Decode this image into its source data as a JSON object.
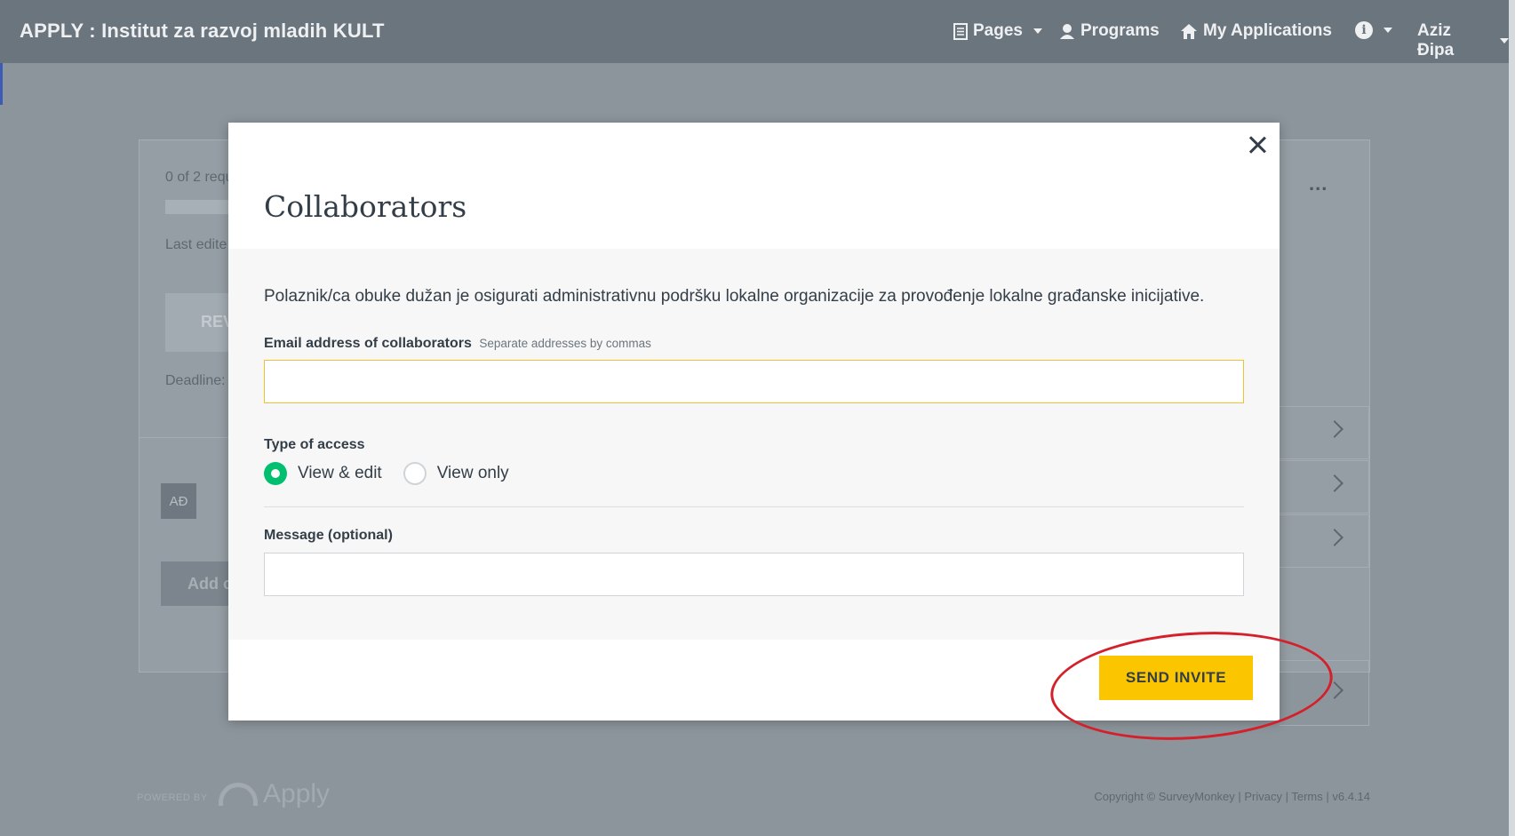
{
  "navbar": {
    "brand": "APPLY : Institut za razvoj mladih KULT",
    "pages": "Pages",
    "programs": "Programs",
    "my_applications": "My Applications",
    "info_icon": "i",
    "user": "Aziz Đipa"
  },
  "background": {
    "requirements": "0 of 2 requ",
    "last_edited": "Last edite",
    "review_button": "REV",
    "deadline": "Deadline:",
    "avatar_initials": "AĐ",
    "add_button": "Add c",
    "more_icon": "..."
  },
  "footer": {
    "powered_by": "POWERED BY",
    "logo_text": "Apply",
    "copyright": "Copyright © SurveyMonkey | Privacy | Terms | v6.4.14"
  },
  "modal": {
    "title": "Collaborators",
    "intro": "Polaznik/ca obuke dužan je osigurati administrativnu podršku lokalne organizacije za provođenje lokalne građanske inicijative.",
    "email_label": "Email address of collaborators",
    "email_hint": "Separate addresses by commas",
    "email_value": "",
    "access_label": "Type of access",
    "access_options": [
      "View & edit",
      "View only"
    ],
    "access_selected": "View & edit",
    "message_label": "Message (optional)",
    "message_value": "",
    "send_button": "SEND INVITE"
  },
  "colors": {
    "navbar": "#6b757e",
    "overlay": "#8c959c",
    "send_button": "#fbc500",
    "radio_selected": "#00bf6f",
    "annotation": "#d4202a"
  },
  "icons": [
    "document-icon",
    "caret-down-icon",
    "user-icon",
    "home-icon",
    "info-icon",
    "close-icon",
    "chevron-right-icon",
    "more-icon"
  ]
}
